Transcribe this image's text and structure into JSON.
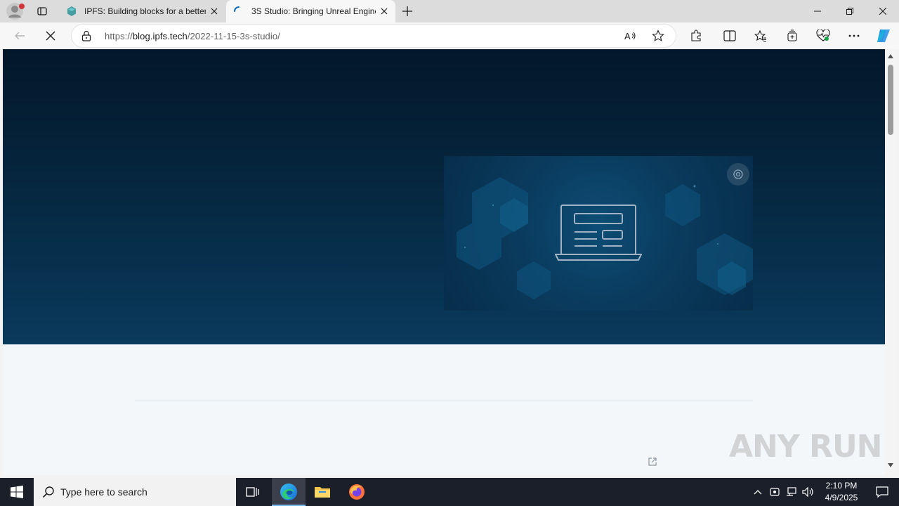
{
  "browser": {
    "tabs": [
      {
        "title": "IPFS: Building blocks for a better",
        "active": false
      },
      {
        "title": "3S Studio: Bringing Unreal Engine",
        "active": true
      }
    ],
    "url_prefix": "https://",
    "url_host": "blog.ipfs.tech",
    "url_path": "/2022-11-15-3s-studio/"
  },
  "page": {
    "hero_bg": "#062a44",
    "accent": "#0a3b5e"
  },
  "watermark": "ANY RUN",
  "taskbar": {
    "search_placeholder": "Type here to search",
    "time": "2:10 PM",
    "date": "4/9/2025"
  }
}
